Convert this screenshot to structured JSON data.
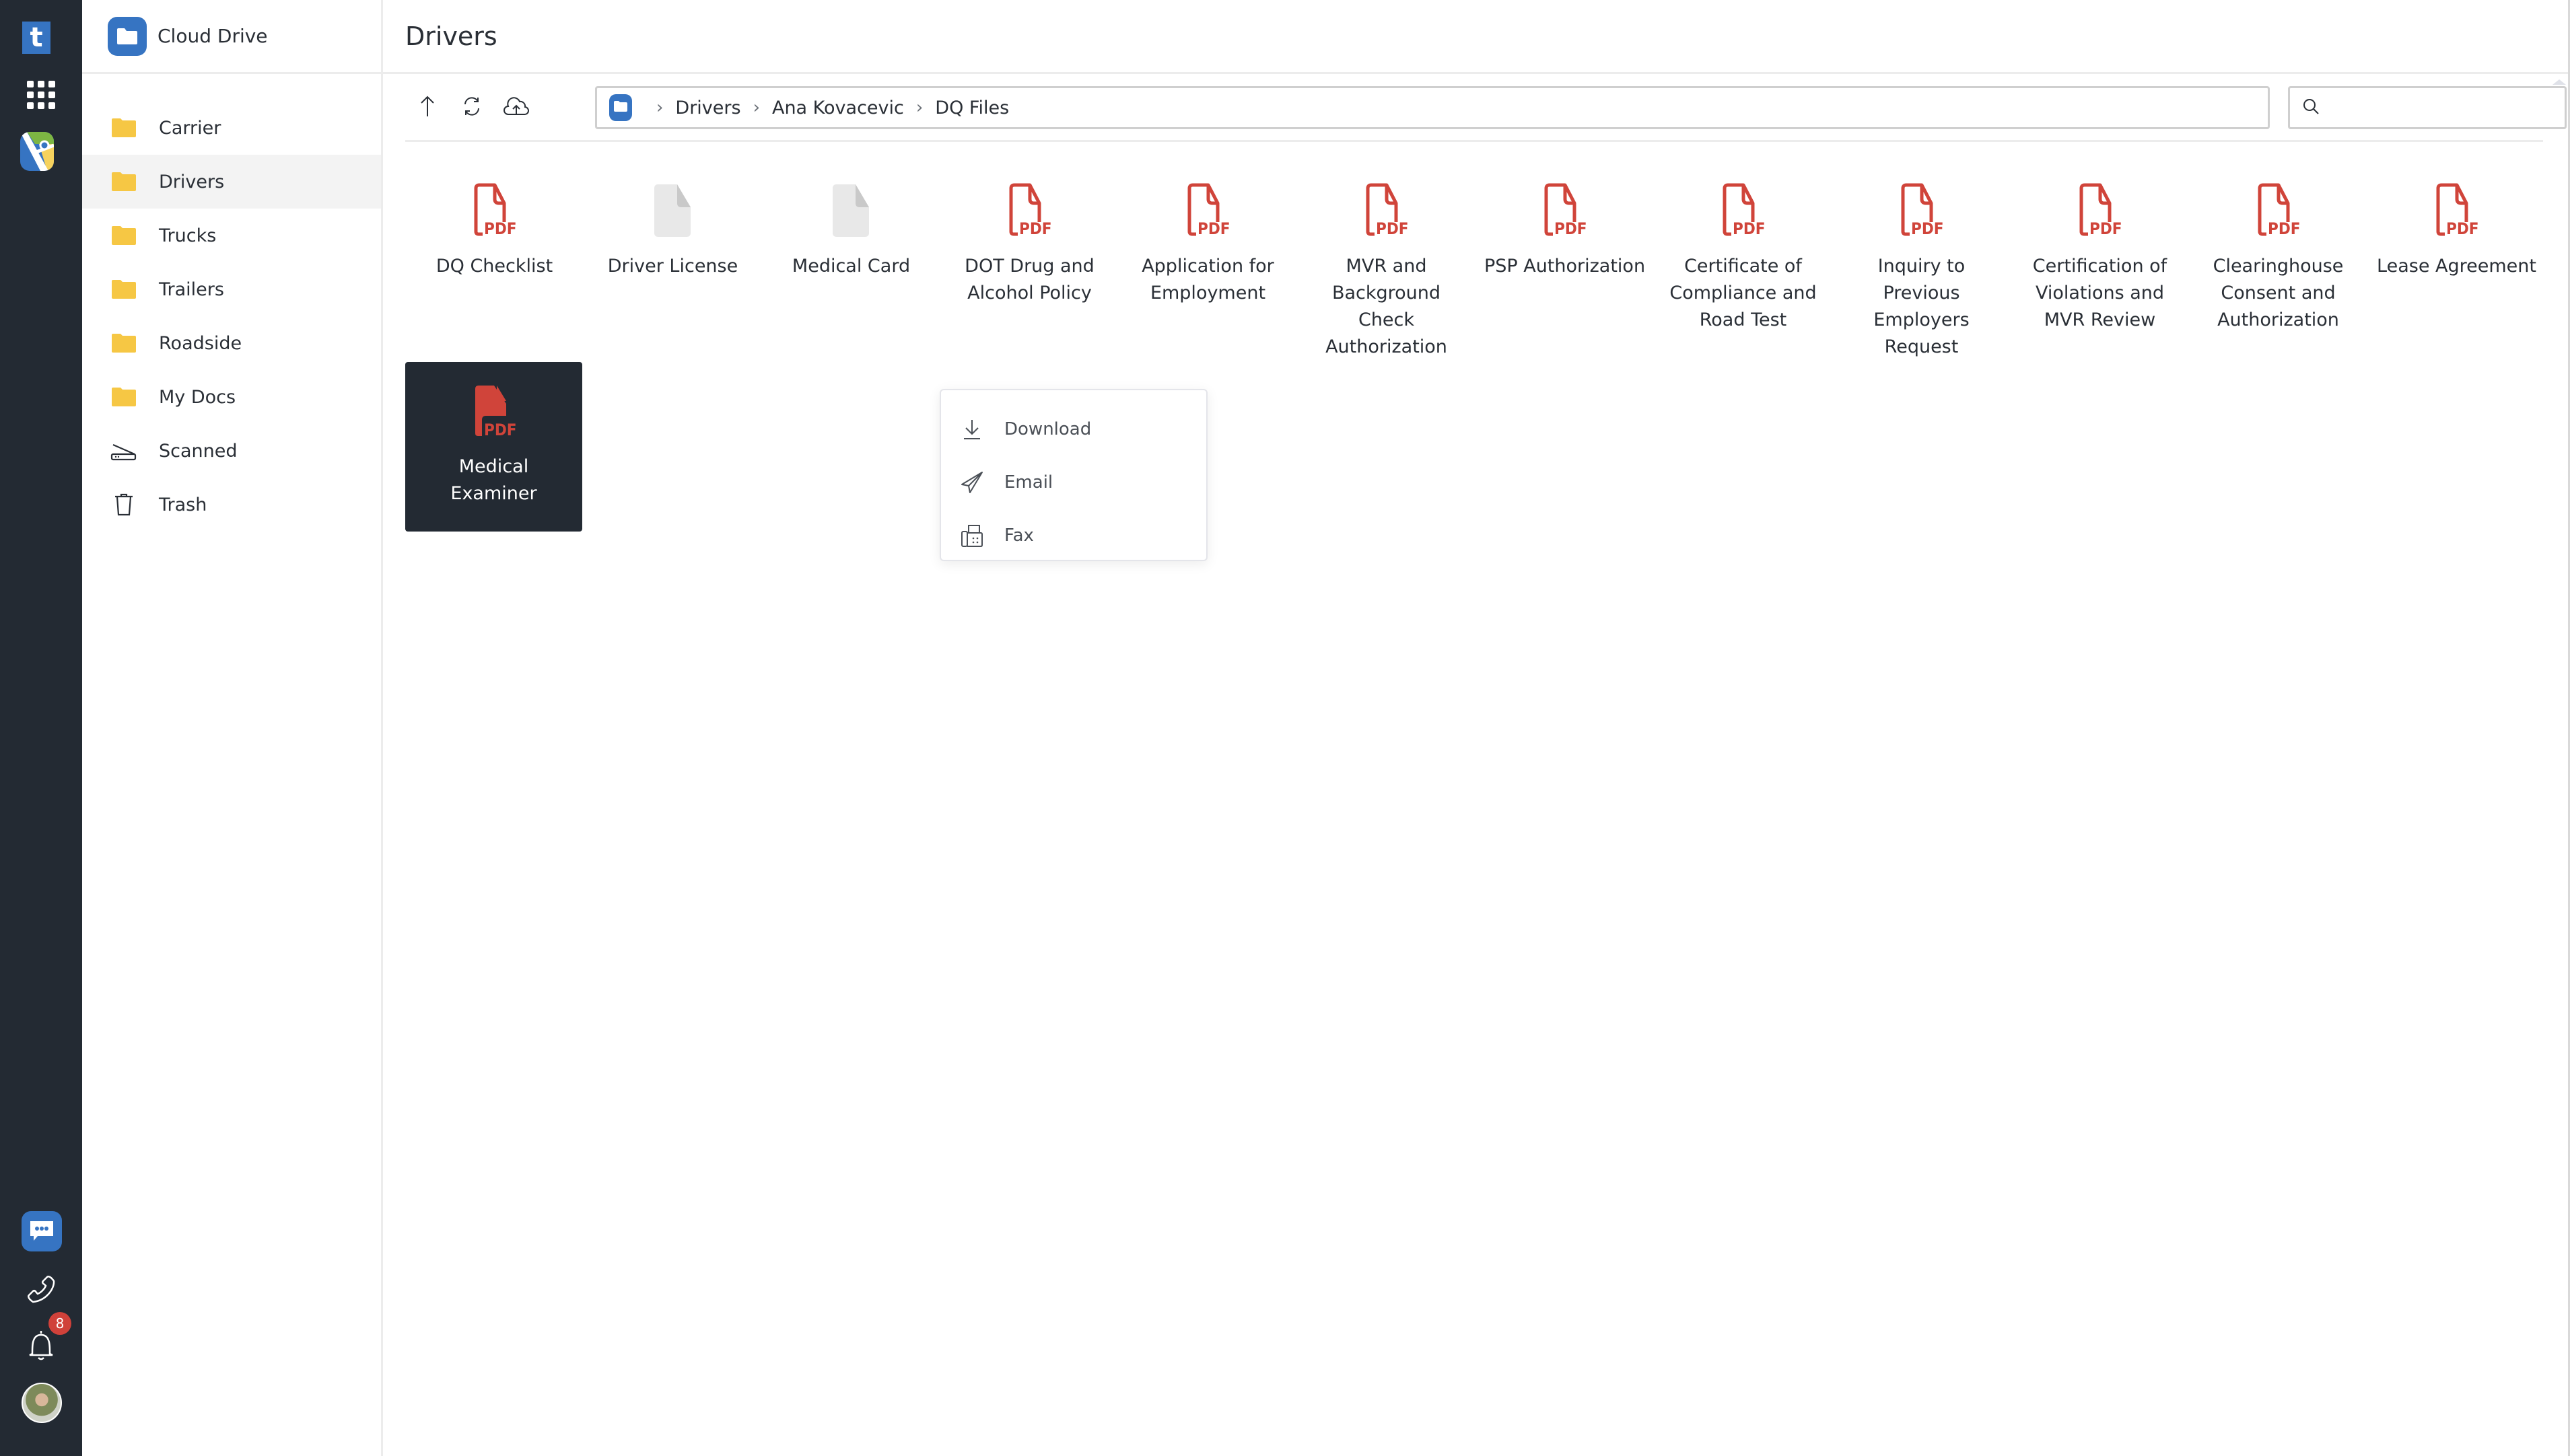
{
  "rail": {
    "logo_letter": "t",
    "notifications_count": "8",
    "items": [
      {
        "name": "apps-grid-icon"
      },
      {
        "name": "maps-app-icon"
      },
      {
        "name": "chat-icon"
      },
      {
        "name": "phone-icon"
      },
      {
        "name": "bell-icon"
      },
      {
        "name": "user-avatar"
      }
    ]
  },
  "sidebar": {
    "app_title": "Cloud Drive",
    "items": [
      {
        "label": "Carrier",
        "icon": "folder-icon",
        "active": false
      },
      {
        "label": "Drivers",
        "icon": "folder-icon",
        "active": true
      },
      {
        "label": "Trucks",
        "icon": "folder-icon",
        "active": false
      },
      {
        "label": "Trailers",
        "icon": "folder-icon",
        "active": false
      },
      {
        "label": "Roadside",
        "icon": "folder-icon",
        "active": false
      },
      {
        "label": "My Docs",
        "icon": "folder-icon",
        "active": false
      },
      {
        "label": "Scanned",
        "icon": "scanner-icon",
        "active": false
      },
      {
        "label": "Trash",
        "icon": "trash-icon",
        "active": false
      }
    ]
  },
  "header": {
    "title": "Drivers"
  },
  "toolbar": {
    "buttons": [
      {
        "name": "go-up-button",
        "icon": "arrow-up-icon"
      },
      {
        "name": "refresh-button",
        "icon": "refresh-icon"
      },
      {
        "name": "upload-button",
        "icon": "cloud-upload-icon"
      }
    ],
    "breadcrumb": [
      "Drivers",
      "Ana Kovacevic",
      "DQ Files"
    ],
    "search_placeholder": ""
  },
  "files": [
    {
      "name": "DQ Checklist",
      "type": "pdf"
    },
    {
      "name": "Driver License",
      "type": "blank"
    },
    {
      "name": "Medical Card",
      "type": "blank"
    },
    {
      "name": "DOT Drug and Alcohol Policy",
      "type": "pdf"
    },
    {
      "name": "Application for Employment",
      "type": "pdf"
    },
    {
      "name": "MVR and Background Check Authorization",
      "type": "pdf"
    },
    {
      "name": "PSP Authorization",
      "type": "pdf"
    },
    {
      "name": "Certificate of Compliance and Road Test",
      "type": "pdf"
    },
    {
      "name": "Inquiry to Previous Employers Request",
      "type": "pdf"
    },
    {
      "name": "Certification of Violations and MVR Review",
      "type": "pdf"
    },
    {
      "name": "Clearinghouse Consent and Authorization",
      "type": "pdf"
    },
    {
      "name": "Lease Agreement",
      "type": "pdf"
    },
    {
      "name": "Medical Examiner Verification",
      "type": "pdf",
      "selected": true
    }
  ],
  "context_menu": {
    "items": [
      {
        "label": "Download",
        "icon": "download-icon"
      },
      {
        "label": "Email",
        "icon": "send-icon"
      },
      {
        "label": "Fax",
        "icon": "fax-icon"
      }
    ]
  },
  "colors": {
    "rail_bg": "#232a33",
    "accent_blue": "#3674c2",
    "folder_yellow": "#f6c744",
    "pdf_red": "#d0443a",
    "badge_red": "#d0413a",
    "selected_tile": "#232a33"
  }
}
